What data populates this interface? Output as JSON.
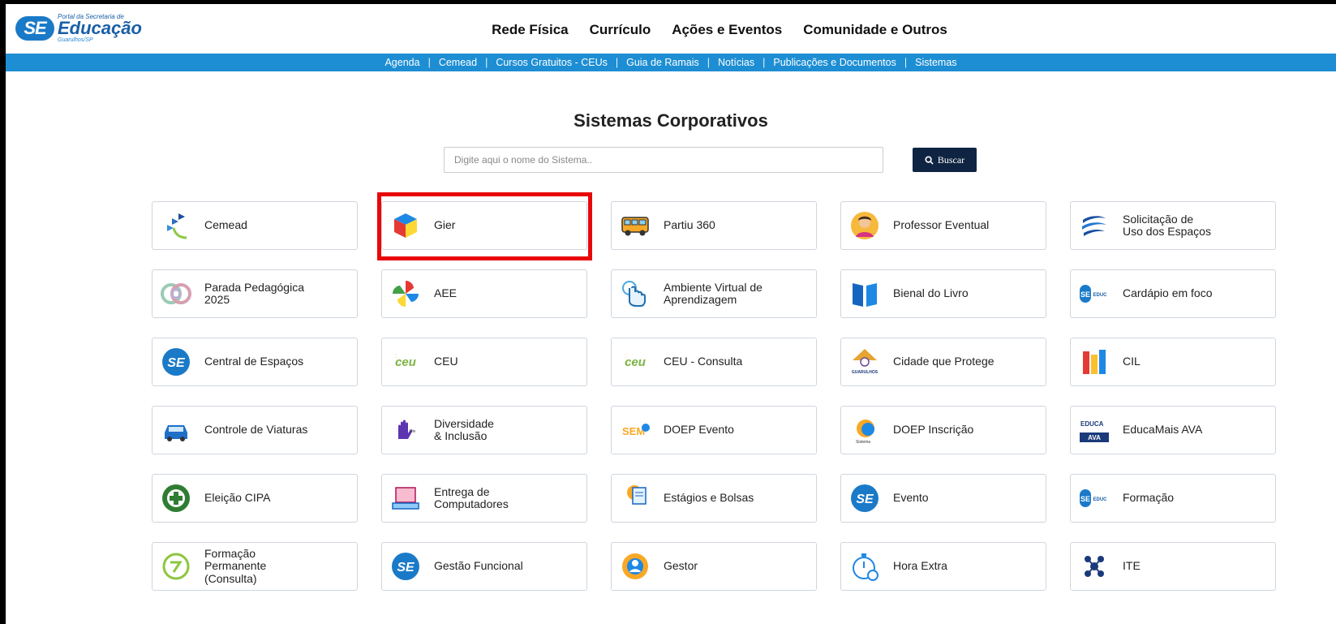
{
  "logo": {
    "badge": "SE",
    "small": "Portal da Secretaria de",
    "main": "Educação",
    "city": "Guarulhos/SP"
  },
  "main_nav": [
    "Rede Física",
    "Currículo",
    "Ações e Eventos",
    "Comunidade e Outros"
  ],
  "sub_nav": [
    "Agenda",
    "Cemead",
    "Cursos Gratuitos - CEUs",
    "Guia de Ramais",
    "Notícias",
    "Publicações e Documentos",
    "Sistemas"
  ],
  "page_title": "Sistemas Corporativos",
  "search": {
    "placeholder": "Digite aqui o nome do Sistema..",
    "button_label": "Buscar"
  },
  "systems": [
    {
      "label": "Cemead",
      "icon": "cemead-icon"
    },
    {
      "label": "Gier",
      "icon": "cube-icon"
    },
    {
      "label": "Partiu 360",
      "icon": "bus-icon"
    },
    {
      "label": "Professor Eventual",
      "icon": "teacher-icon"
    },
    {
      "label": "Solicitação de\nUso dos Espaços",
      "icon": "swirl-icon"
    },
    {
      "label": "Parada Pedagógica\n2025",
      "icon": "rings-icon"
    },
    {
      "label": "AEE",
      "icon": "pinwheel-icon"
    },
    {
      "label": "Ambiente Virtual de\nAprendizagem",
      "icon": "touch-icon"
    },
    {
      "label": "Bienal do Livro",
      "icon": "book-icon"
    },
    {
      "label": "Cardápio em foco",
      "icon": "se-educacao-icon"
    },
    {
      "label": "Central de Espaços",
      "icon": "se-icon"
    },
    {
      "label": "CEU",
      "icon": "ceu-icon"
    },
    {
      "label": "CEU - Consulta",
      "icon": "ceu-icon"
    },
    {
      "label": "Cidade que Protege",
      "icon": "guarulhos-icon"
    },
    {
      "label": "CIL",
      "icon": "books-icon"
    },
    {
      "label": "Controle de Viaturas",
      "icon": "car-icon"
    },
    {
      "label": "Diversidade\n& Inclusão",
      "icon": "hand-icon"
    },
    {
      "label": "DOEP Evento",
      "icon": "sem-icon"
    },
    {
      "label": "DOEP Inscrição",
      "icon": "sun-icon"
    },
    {
      "label": "EducaMais AVA",
      "icon": "educamais-icon"
    },
    {
      "label": "Eleição CIPA",
      "icon": "cross-icon"
    },
    {
      "label": "Entrega de\nComputadores",
      "icon": "laptop-icon"
    },
    {
      "label": "Estágios e Bolsas",
      "icon": "clipboard-icon"
    },
    {
      "label": "Evento",
      "icon": "se-icon"
    },
    {
      "label": "Formação",
      "icon": "se-educacao-icon"
    },
    {
      "label": "Formação\nPermanente\n(Consulta)",
      "icon": "circle-arrow-icon"
    },
    {
      "label": "Gestão Funcional",
      "icon": "se-icon"
    },
    {
      "label": "Gestor",
      "icon": "gear-person-icon"
    },
    {
      "label": "Hora Extra",
      "icon": "stopwatch-icon"
    },
    {
      "label": "ITE",
      "icon": "circuit-icon"
    }
  ],
  "colors": {
    "brand_blue": "#1a7ac8",
    "subnav_blue": "#1d8ed3",
    "search_button": "#0f2442",
    "highlight_red": "#e8080a"
  }
}
